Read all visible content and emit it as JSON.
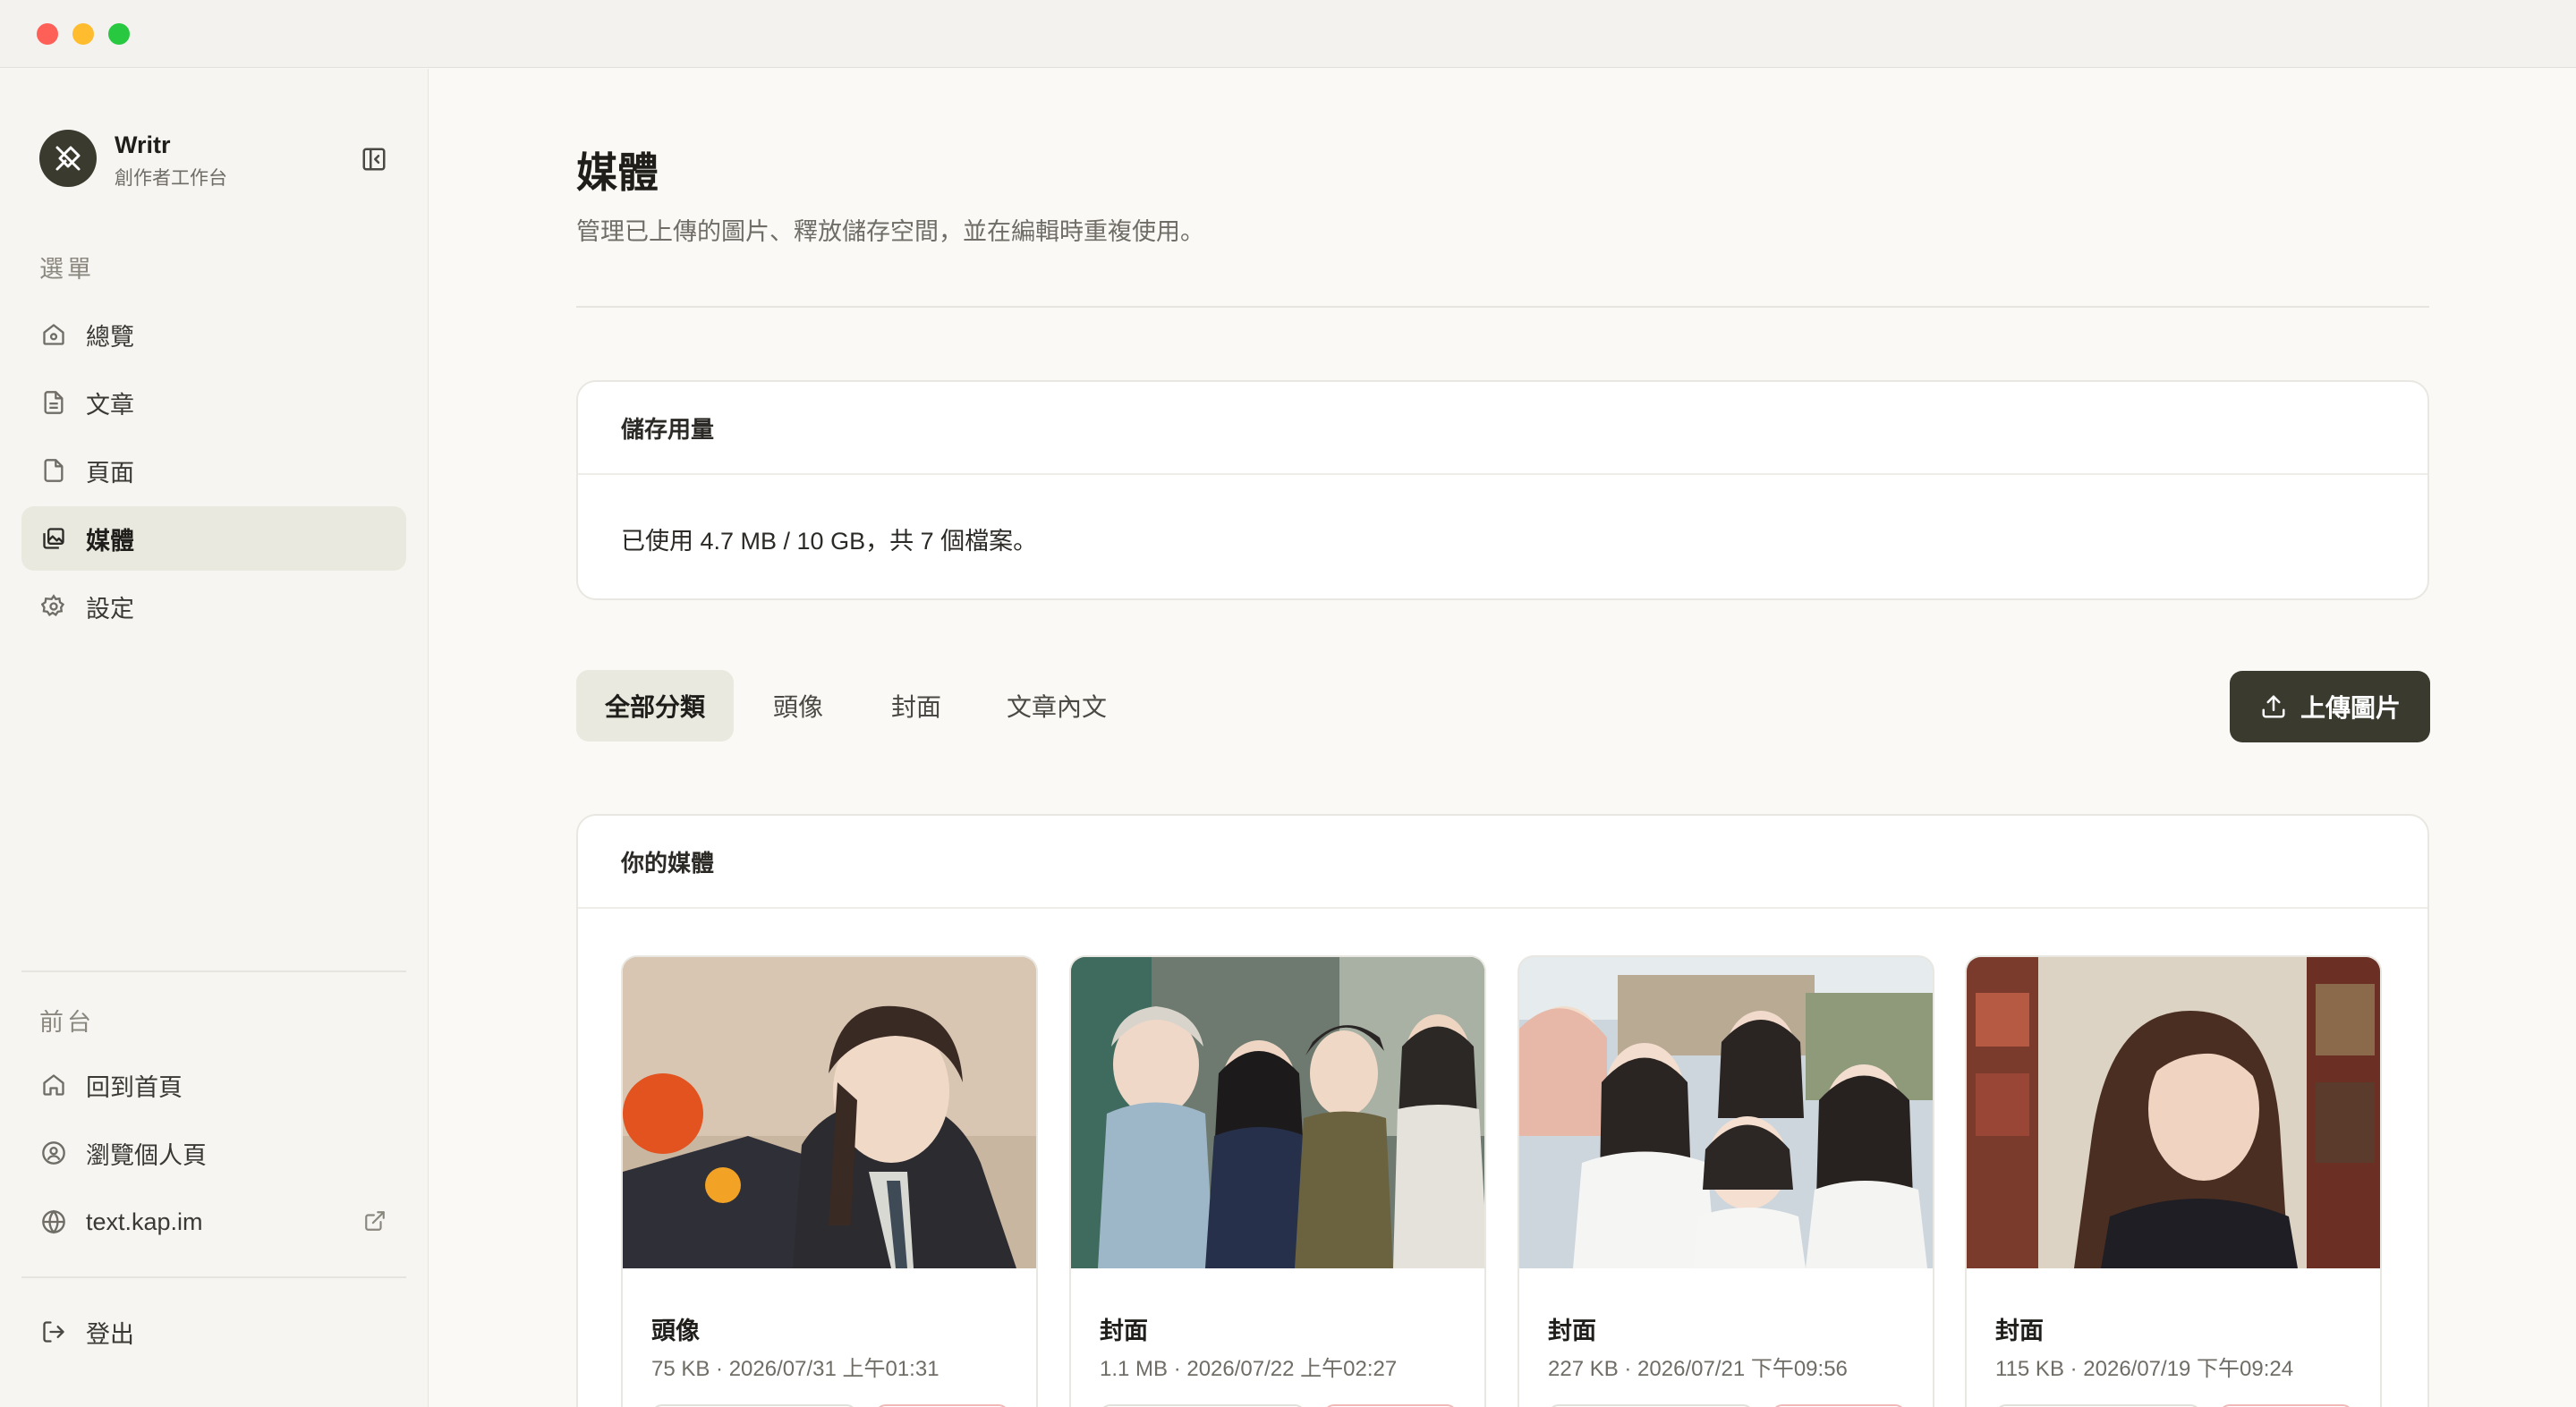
{
  "app": {
    "name": "Writr",
    "subtitle": "創作者工作台"
  },
  "sidebar": {
    "menu_label": "選單",
    "menu": [
      {
        "label": "總覽",
        "icon": "home-icon"
      },
      {
        "label": "文章",
        "icon": "document-icon"
      },
      {
        "label": "頁面",
        "icon": "page-icon"
      },
      {
        "label": "媒體",
        "icon": "media-icon",
        "active": true
      },
      {
        "label": "設定",
        "icon": "gear-icon"
      }
    ],
    "front_label": "前台",
    "front": [
      {
        "label": "回到首頁",
        "icon": "home-outline-icon"
      },
      {
        "label": "瀏覽個人頁",
        "icon": "user-circle-icon"
      },
      {
        "label": "text.kap.im",
        "icon": "globe-icon"
      }
    ],
    "logout_label": "登出"
  },
  "page": {
    "title": "媒體",
    "subtitle": "管理已上傳的圖片、釋放儲存空間，並在編輯時重複使用。"
  },
  "storage": {
    "heading": "儲存用量",
    "text": "已使用 4.7 MB / 10 GB，共 7 個檔案。"
  },
  "tabs": [
    {
      "label": "全部分類",
      "active": true
    },
    {
      "label": "頭像"
    },
    {
      "label": "封面"
    },
    {
      "label": "文章內文"
    }
  ],
  "upload_label": "上傳圖片",
  "media": {
    "heading": "你的媒體",
    "items": [
      {
        "title": "頭像",
        "meta": "75 KB · 2026/07/31 上午01:31"
      },
      {
        "title": "封面",
        "meta": "1.1 MB · 2026/07/22 上午02:27"
      },
      {
        "title": "封面",
        "meta": "227 KB · 2026/07/21 下午09:56"
      },
      {
        "title": "封面",
        "meta": "115 KB · 2026/07/19 下午09:24"
      }
    ]
  },
  "colors": {
    "accent": "#3a3a2e",
    "active_bg": "#e9e9df",
    "background": "#faf9f5",
    "danger_border": "#f2b8b8"
  }
}
